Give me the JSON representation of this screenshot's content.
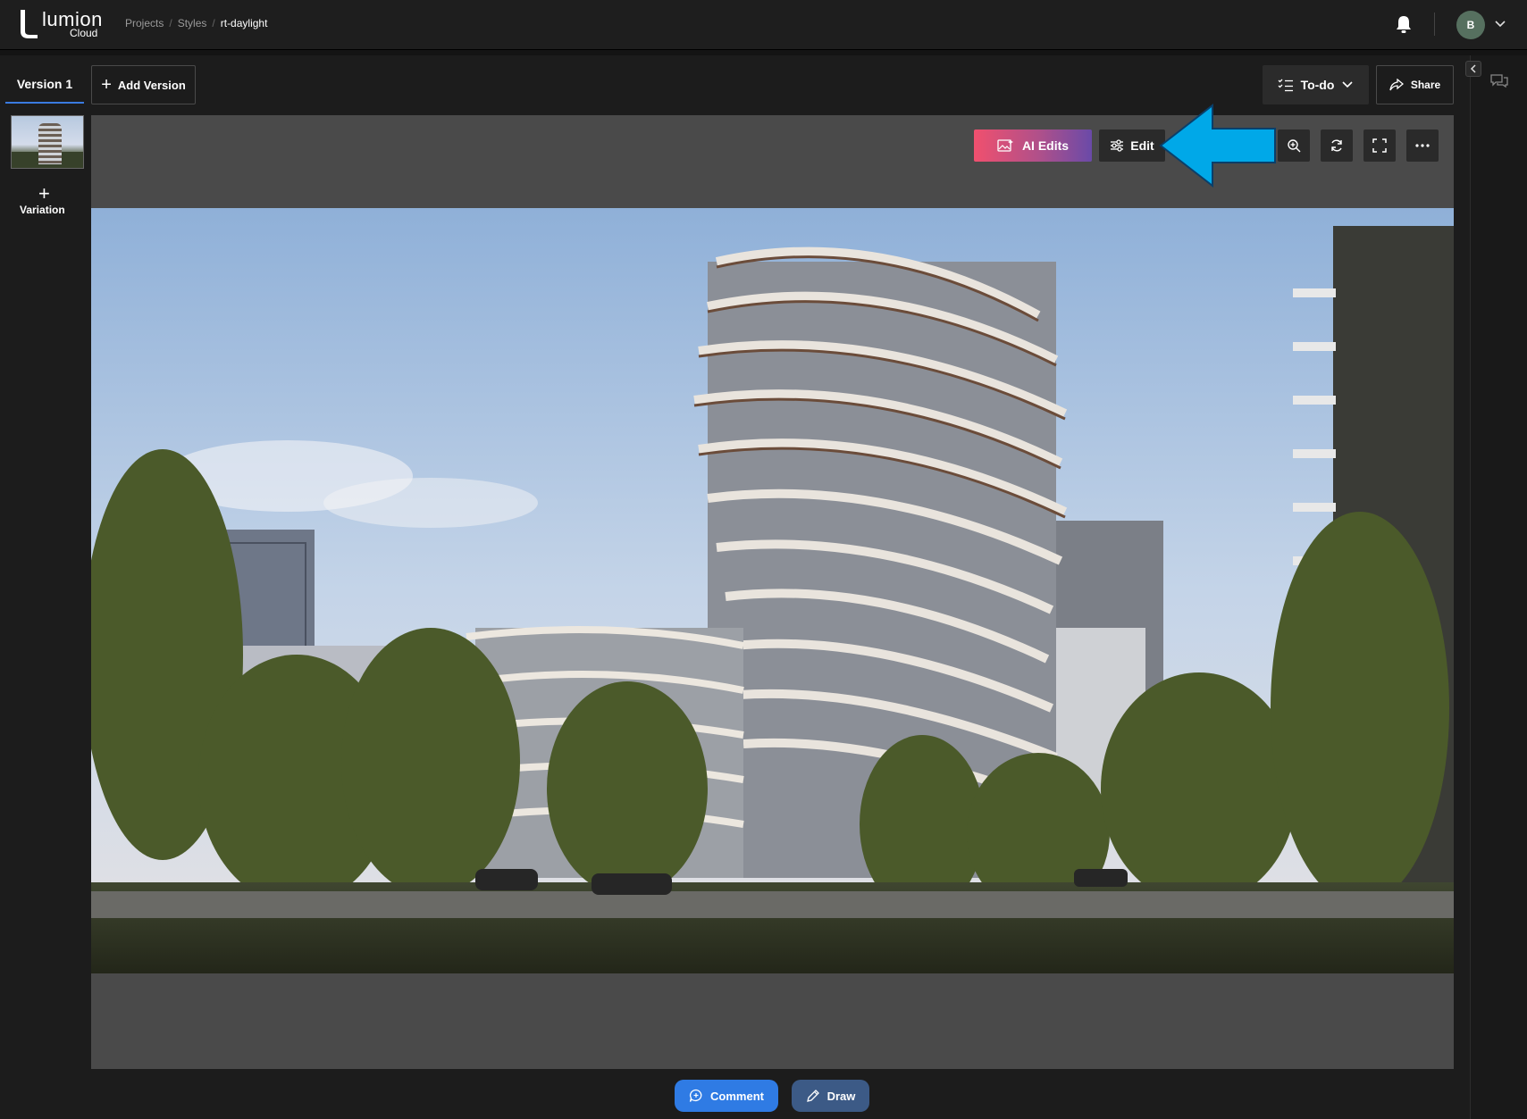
{
  "app": {
    "logo_word": "lumion",
    "logo_sub": "Cloud"
  },
  "breadcrumb": {
    "items": [
      "Projects",
      "Styles"
    ],
    "separator": "/",
    "current": "rt-daylight"
  },
  "user": {
    "avatar_initial": "B"
  },
  "toolbar": {
    "version_tab": "Version 1",
    "add_version_label": "Add Version",
    "todo_label": "To-do",
    "share_label": "Share"
  },
  "variations": {
    "add_label": "Variation"
  },
  "canvas_toolbar": {
    "ai_edits_label": "AI Edits",
    "edit_label": "Edit",
    "icons": [
      "zoom-in-icon",
      "refresh-icon",
      "fullscreen-icon",
      "more-icon"
    ]
  },
  "annotations": {
    "callout_color": "#00a8e8"
  },
  "bottom_actions": {
    "comment_label": "Comment",
    "draw_label": "Draw"
  },
  "colors": {
    "accent_blue": "#2f7be4",
    "draw_blue": "#3c5a86",
    "ai_gradient_start": "#f0506e",
    "ai_gradient_end": "#6a4aa8"
  }
}
